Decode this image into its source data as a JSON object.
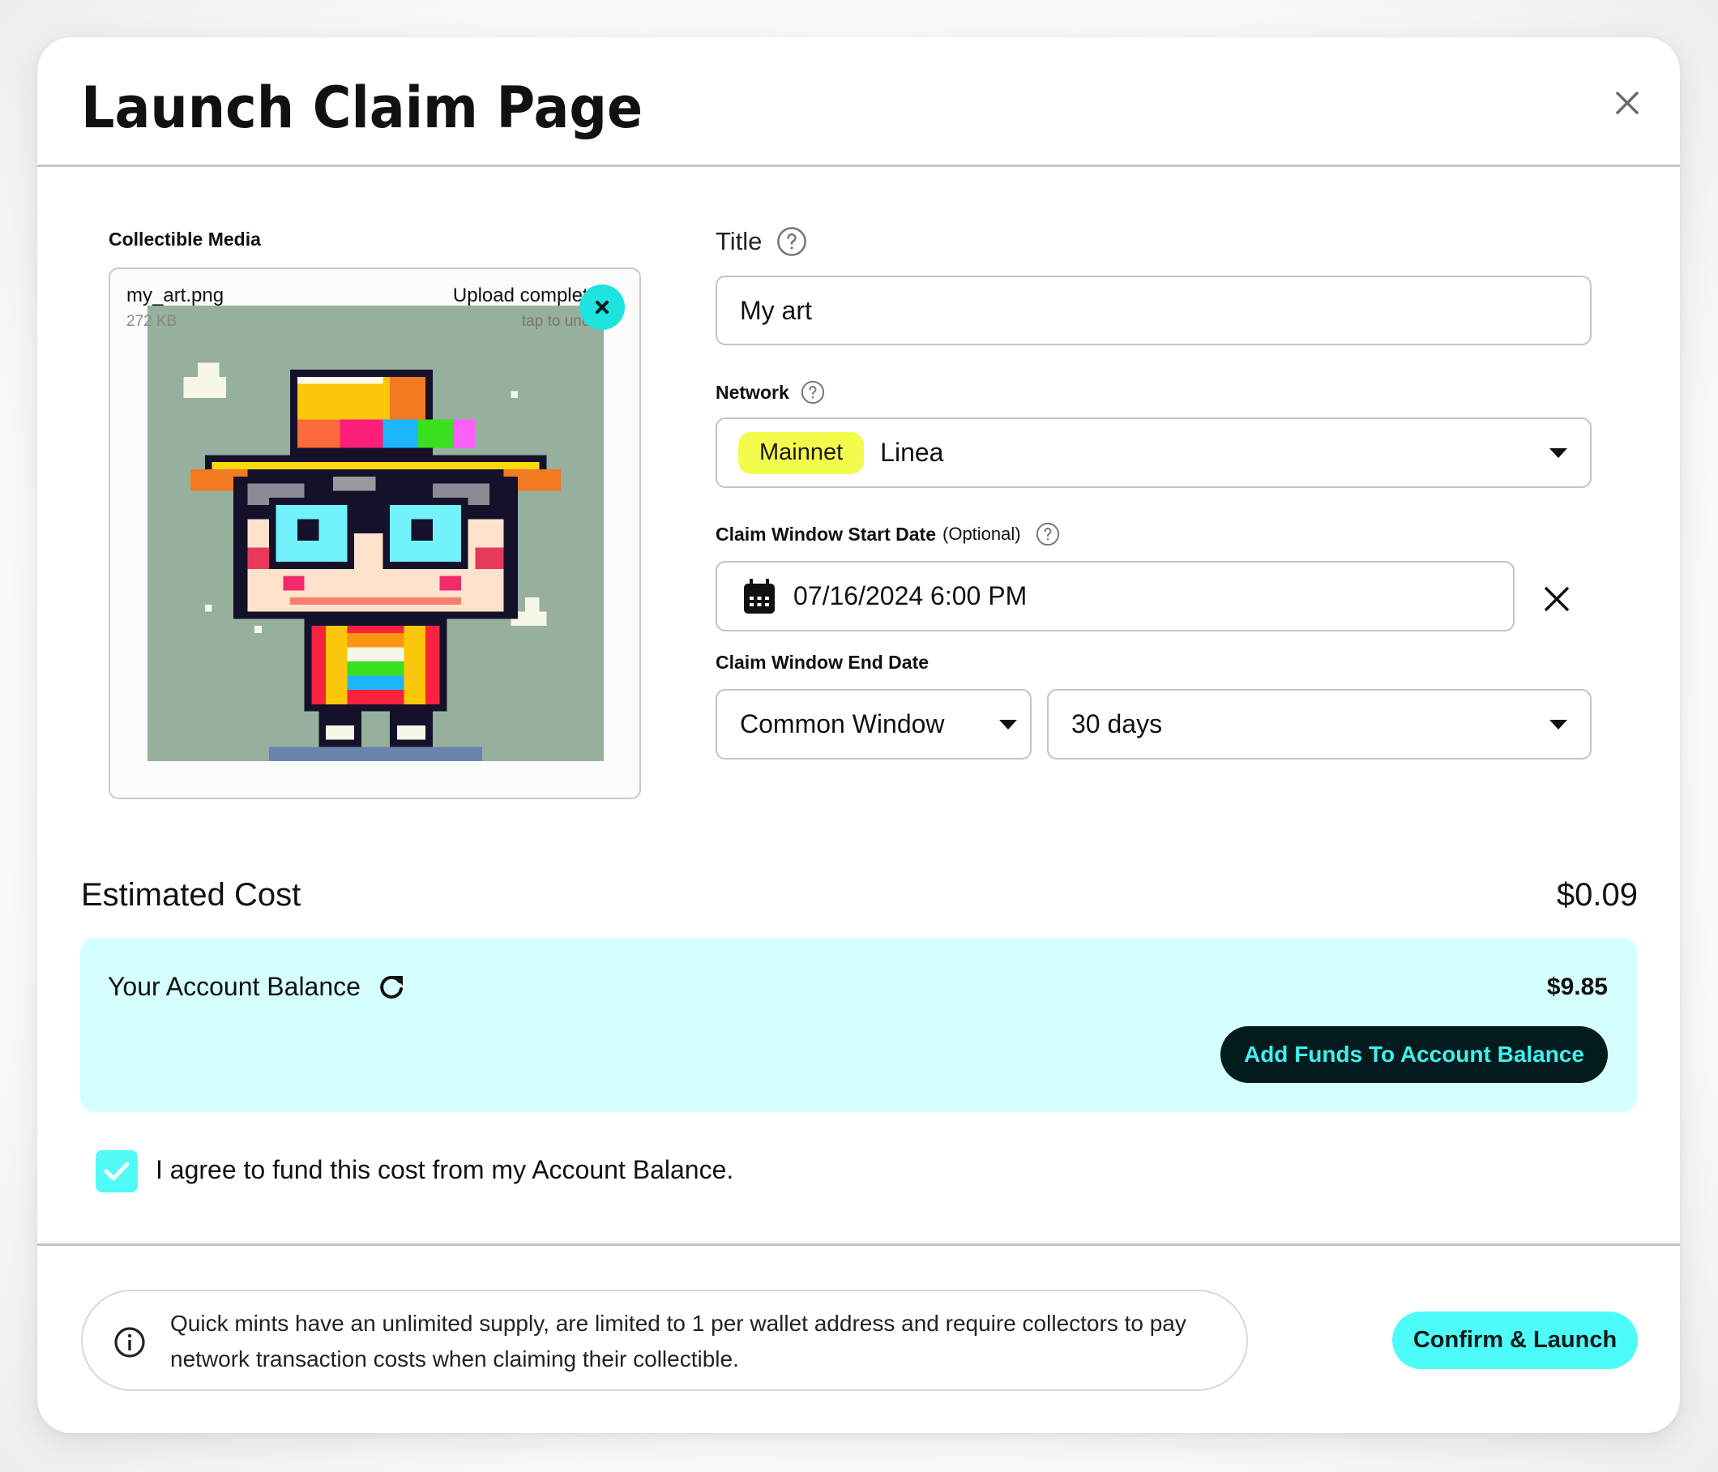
{
  "dialog": {
    "title": "Launch Claim Page",
    "close_icon": "close-icon"
  },
  "media": {
    "label": "Collectible Media",
    "file_name": "my_art.png",
    "file_size": "272 KB",
    "status": "Upload complete",
    "undo_hint": "tap to undo",
    "remove_icon": "close-icon",
    "image_description": "pixel-art character with rainbow-banded straw hat and round cyan glasses"
  },
  "form": {
    "title_field": {
      "label": "Title",
      "value": "My art",
      "help_icon": "help-circle-icon"
    },
    "network_field": {
      "label": "Network",
      "badge": "Mainnet",
      "value": "Linea",
      "help_icon": "help-circle-icon"
    },
    "start_date_field": {
      "label": "Claim Window Start Date",
      "optional_hint": "(Optional)",
      "value": "07/16/2024 6:00 PM",
      "icon": "calendar-icon",
      "clear_icon": "close-icon"
    },
    "end_date_field": {
      "label": "Claim Window End Date",
      "type_value": "Common Window",
      "duration_value": "30 days"
    }
  },
  "cost": {
    "label": "Estimated Cost",
    "value": "$0.09"
  },
  "balance": {
    "label": "Your Account Balance",
    "refresh_icon": "refresh-icon",
    "value": "$9.85",
    "add_funds_label": "Add Funds To Account Balance"
  },
  "agreement": {
    "checked": true,
    "label": "I agree to fund this cost from my Account Balance."
  },
  "footer": {
    "info_icon": "info-icon",
    "info_text": "Quick mints have an unlimited supply, are limited to 1 per wallet address and require collectors to pay network transaction costs when claiming their collectible.",
    "confirm_label": "Confirm & Launch"
  },
  "colors": {
    "accent_cyan": "#4dfcf8",
    "panel_cyan": "#d5fefe",
    "badge_yellow": "#f3fb4d",
    "dark_button": "#041b1d"
  }
}
